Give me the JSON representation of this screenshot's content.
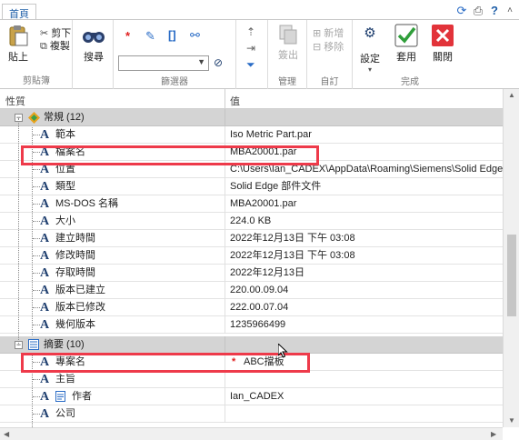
{
  "tabs": {
    "home": "首頁"
  },
  "quick_access": [
    "refresh-icon",
    "print-icon",
    "help-icon",
    "collapse-ribbon-icon"
  ],
  "ribbon": {
    "clipboard": {
      "group": "剪貼簿",
      "paste": "貼上",
      "cut": "剪下",
      "copy": "複製"
    },
    "search": {
      "find": "搜尋"
    },
    "filter": {
      "group": "篩選器",
      "combo_value": ""
    },
    "manage": {
      "group": "管理",
      "submit": "簽出"
    },
    "custom": {
      "group": "自訂",
      "add": "新增",
      "remove": "移除"
    },
    "done": {
      "group": "完成",
      "settings": "設定",
      "apply": "套用",
      "close": "關閉"
    }
  },
  "grid": {
    "col_property": "性質",
    "col_value": "值",
    "general": {
      "title": "常規 (12)",
      "rows": [
        {
          "name": "範本",
          "value": "Iso Metric Part.par"
        },
        {
          "name": "檔案名",
          "value": "MBA20001.par"
        },
        {
          "name": "位置",
          "value": "C:\\Users\\Ian_CADEX\\AppData\\Roaming\\Siemens\\Solid Edge\\Sl"
        },
        {
          "name": "類型",
          "value": "Solid Edge 部件文件"
        },
        {
          "name": "MS-DOS 名稱",
          "value": "MBA20001.par"
        },
        {
          "name": "大小",
          "value": "224.0 KB"
        },
        {
          "name": "建立時間",
          "value": "2022年12月13日  下午 03:08"
        },
        {
          "name": "修改時間",
          "value": "2022年12月13日  下午 03:08"
        },
        {
          "name": "存取時間",
          "value": "2022年12月13日"
        },
        {
          "name": "版本已建立",
          "value": "220.00.09.04"
        },
        {
          "name": "版本已修改",
          "value": "222.00.07.04"
        },
        {
          "name": "幾何版本",
          "value": "1235966499"
        }
      ]
    },
    "summary": {
      "title": "摘要 (10)",
      "rows": [
        {
          "name": "專案名",
          "value": "ABC擋板",
          "required": "*"
        },
        {
          "name": "主旨",
          "value": ""
        },
        {
          "name": "作者",
          "value": "Ian_CADEX"
        },
        {
          "name": "公司",
          "value": ""
        }
      ]
    }
  },
  "colors": {
    "highlight": "#ee3a4a",
    "section_bg": "#d4d4d4",
    "accent": "#1f5fa8"
  }
}
